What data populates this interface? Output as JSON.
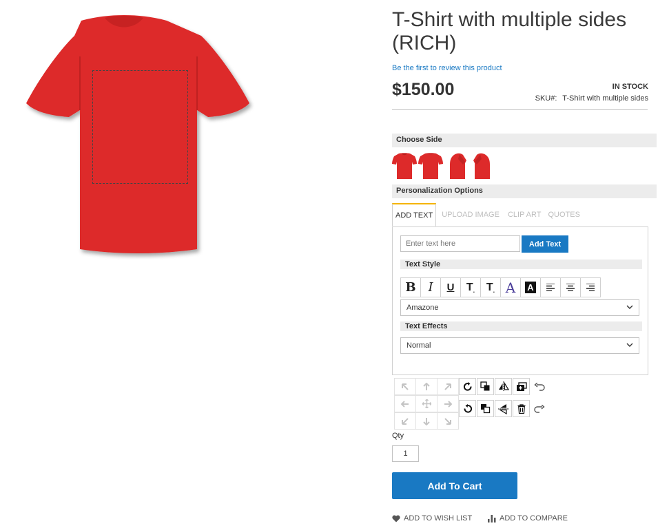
{
  "product": {
    "title": "T-Shirt with multiple sides (RICH)",
    "review_link": "Be the first to review this product",
    "price": "$150.00",
    "stock": "IN STOCK",
    "sku_label": "SKU#:",
    "sku_value": "T-Shirt with multiple sides",
    "color": "#e02a2a"
  },
  "choose_side": {
    "heading": "Choose Side",
    "sides": [
      "front",
      "back",
      "left",
      "right"
    ]
  },
  "personalization": {
    "heading": "Personalization Options",
    "tabs": [
      {
        "label": "ADD TEXT",
        "active": true
      },
      {
        "label": "UPLOAD IMAGE",
        "active": false
      },
      {
        "label": "CLIP ART",
        "active": false
      },
      {
        "label": "QUOTES",
        "active": false
      }
    ],
    "text_placeholder": "Enter text here",
    "add_text_button": "Add Text",
    "text_style_heading": "Text Style",
    "style_tools": [
      "bold-icon",
      "italic-icon",
      "underline-icon",
      "text-shadow-icon",
      "text-outline-icon",
      "text-color-icon",
      "text-background-icon",
      "align-left-icon",
      "align-center-icon",
      "align-right-icon"
    ],
    "font_select": "Amazone",
    "text_effects_heading": "Text Effects",
    "effect_select": "Normal"
  },
  "transform_tools": {
    "move": [
      "arrow-up-left-icon",
      "arrow-up-icon",
      "arrow-up-right-icon",
      "arrow-left-icon",
      "move-icon",
      "arrow-right-icon",
      "arrow-down-left-icon",
      "arrow-down-icon",
      "arrow-down-right-icon"
    ],
    "actions": [
      "rotate-cw-icon",
      "bring-forward-icon",
      "flip-horizontal-icon",
      "duplicate-icon",
      "undo-icon",
      "rotate-ccw-icon",
      "send-backward-icon",
      "flip-vertical-icon",
      "delete-icon",
      "redo-icon"
    ]
  },
  "cart": {
    "qty_label": "Qty",
    "qty_value": "1",
    "add_to_cart": "Add To Cart",
    "wish_list": "ADD TO WISH LIST",
    "compare": "ADD TO COMPARE"
  },
  "colors": {
    "accent": "#1979c3",
    "tab_highlight": "#f5b400",
    "section_bg": "#ececec"
  }
}
